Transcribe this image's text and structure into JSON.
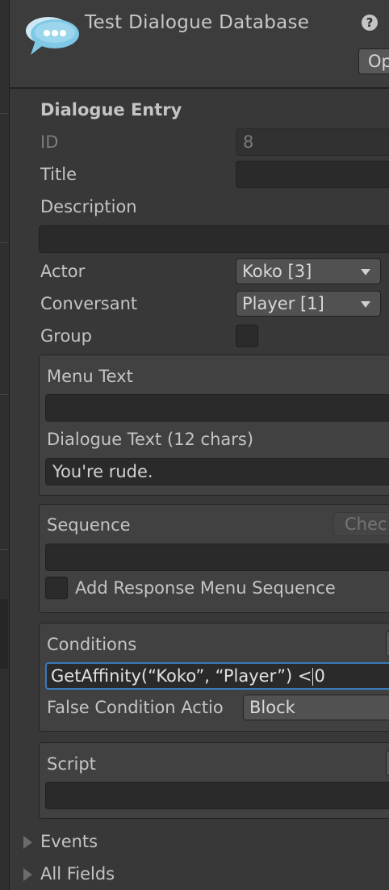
{
  "header": {
    "title": "Test Dialogue Database",
    "help_glyph": "?",
    "menu_glyph": "⋮",
    "open_button": "Op"
  },
  "entry": {
    "section_title": "Dialogue Entry",
    "id_label": "ID",
    "id_value": "8",
    "title_label": "Title",
    "title_value": "",
    "description_label": "Description",
    "description_value": "",
    "actor_label": "Actor",
    "actor_value": "Koko [3]",
    "conversant_label": "Conversant",
    "conversant_value": "Player [1]",
    "group_label": "Group",
    "group_checked": false
  },
  "text_panel": {
    "menu_text_label": "Menu Text",
    "menu_text_value": "",
    "dialogue_text_label": "Dialogue Text (12 chars)",
    "dialogue_text_value": "You're rude."
  },
  "sequence_panel": {
    "sequence_label": "Sequence",
    "check_button": "Chec",
    "sequence_value": "",
    "add_response_label": "Add Response Menu Sequence",
    "add_response_checked": false
  },
  "conditions_panel": {
    "conditions_label": "Conditions",
    "conditions_before_caret": "GetAffinity(“Koko”, “Player”) <",
    "conditions_after_caret": "0",
    "false_action_label": "False Condition Actio",
    "false_action_value": "Block"
  },
  "script_panel": {
    "script_label": "Script",
    "script_value": ""
  },
  "foldouts": {
    "events_label": "Events",
    "all_fields_label": "All Fields"
  },
  "colors": {
    "background": "#383838",
    "field": "#2a2a2a",
    "focus_border": "#3a79bb",
    "icon_blue": "#7fc8e6"
  }
}
